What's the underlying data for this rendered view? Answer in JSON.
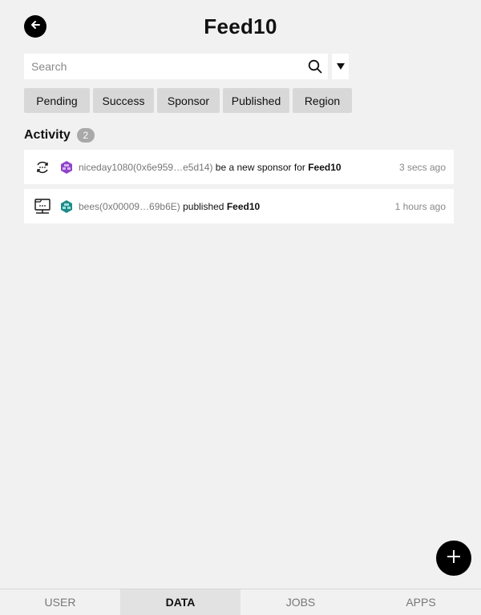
{
  "header": {
    "title": "Feed10",
    "back_icon": "arrow-left-icon"
  },
  "search": {
    "placeholder": "Search",
    "value": "",
    "icon": "search-icon",
    "filter_toggle_icon": "caret-down-icon"
  },
  "filters": [
    {
      "label": "Pending"
    },
    {
      "label": "Success"
    },
    {
      "label": "Sponsor"
    },
    {
      "label": "Published"
    },
    {
      "label": "Region"
    }
  ],
  "activity": {
    "title": "Activity",
    "count": "2",
    "items": [
      {
        "type_icon": "sponsor-sync-icon",
        "actor": "niceday1080(0x6e959…e5d14)",
        "verb": " be a new sponsor for ",
        "object": "Feed10",
        "time": "3 secs ago",
        "avatar_color": "#8e44c9"
      },
      {
        "type_icon": "publish-monitor-icon",
        "actor": "bees(0x00009…69b6E)",
        "verb": " published ",
        "object": "Feed10",
        "time": "1 hours ago",
        "avatar_color": "#1f8a8a"
      }
    ]
  },
  "fab": {
    "icon": "plus-icon"
  },
  "nav": {
    "tabs": [
      {
        "label": "USER"
      },
      {
        "label": "DATA",
        "active": true
      },
      {
        "label": "JOBS"
      },
      {
        "label": "APPS"
      }
    ]
  },
  "colors": {
    "background": "#f1f1f1",
    "chip": "#d8d8d8",
    "active_tab": "#e2e2e2",
    "badge": "#a9a9a9"
  }
}
